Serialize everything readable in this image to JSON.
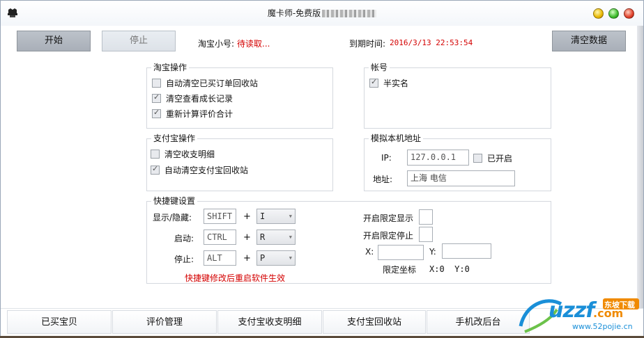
{
  "window": {
    "title": "魔卡师-免费版"
  },
  "toolbar": {
    "start_label": "开始",
    "stop_label": "停止",
    "taobao_account_label": "淘宝小号:",
    "taobao_account_value": "待读取...",
    "expiry_label": "到期时间:",
    "expiry_value": "2016/3/13 22:53:54",
    "clear_data_label": "清空数据"
  },
  "taobao_ops": {
    "title": "淘宝操作",
    "items": [
      {
        "label": "自动清空已买订单回收站",
        "checked": false
      },
      {
        "label": "清空查看成长记录",
        "checked": true
      },
      {
        "label": "重新计算评价合计",
        "checked": true
      }
    ]
  },
  "account": {
    "title": "帐号",
    "items": [
      {
        "label": "半实名",
        "checked": true
      }
    ]
  },
  "alipay_ops": {
    "title": "支付宝操作",
    "items": [
      {
        "label": "清空收支明细",
        "checked": false
      },
      {
        "label": "自动清空支付宝回收站",
        "checked": true
      }
    ]
  },
  "local_addr": {
    "title": "模拟本机地址",
    "ip_label": "IP:",
    "ip_value": "127.0.0.1",
    "enabled_label": "已开启",
    "enabled_checked": false,
    "addr_label": "地址:",
    "addr_value": "上海 电信"
  },
  "hotkeys": {
    "title": "快捷键设置",
    "plus": "+",
    "rows": [
      {
        "label": "显示/隐藏:",
        "modifier": "SHIFT",
        "key": "I"
      },
      {
        "label": "启动:",
        "modifier": "CTRL",
        "key": "R"
      },
      {
        "label": "停止:",
        "modifier": "ALT",
        "key": "P"
      }
    ],
    "note": "快捷键修改后重启软件生效",
    "limit_show_label": "开启限定显示",
    "limit_stop_label": "开启限定停止",
    "x_label": "X:",
    "y_label": "Y:",
    "limit_coord_label": "限定坐标",
    "coord_readout": "X:0  Y:0"
  },
  "tabs": [
    {
      "label": "已买宝贝"
    },
    {
      "label": "评价管理"
    },
    {
      "label": "支付宝收支明细"
    },
    {
      "label": "支付宝回收站"
    },
    {
      "label": "手机改后台"
    }
  ],
  "watermark": {
    "brand": "uzzf",
    "com": ".com",
    "badge": "东坡下载",
    "url": "www.52pojie.cn"
  },
  "colors": {
    "accent_red": "#d40000",
    "button_gray": "#aeb4bc",
    "watermark_blue": "#1a8fd8",
    "watermark_orange": "#f08a00"
  }
}
